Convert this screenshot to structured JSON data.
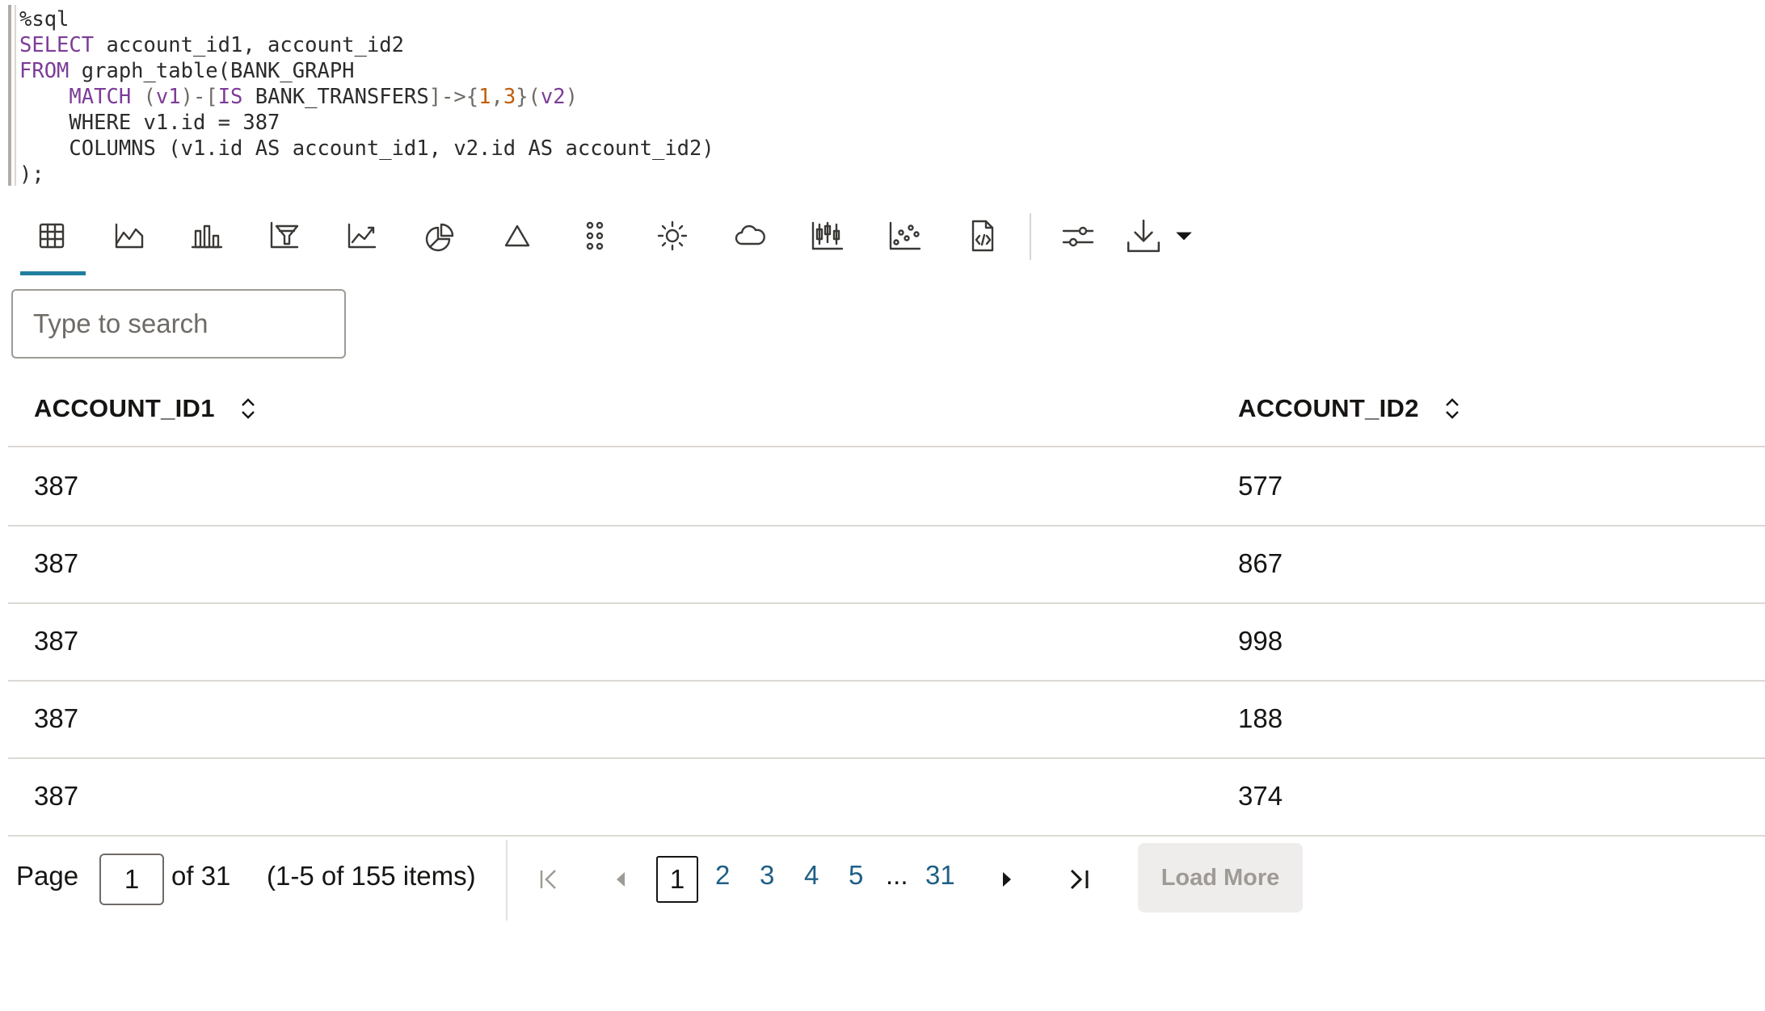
{
  "editor": {
    "line1": "%sql",
    "kw_select": "SELECT",
    "select_cols": " account_id1, account_id2",
    "kw_from": "FROM",
    "from_rest": " graph_table(BANK_GRAPH",
    "kw_match": "MATCH",
    "v1": "v1",
    "kw_is": "IS",
    "edge_label": " BANK_TRANSFERS",
    "min": "1",
    "max": "3",
    "v2": "v2",
    "where_line": "WHERE v1.id = 387",
    "columns_line": "COLUMNS (v1.id AS account_id1, v2.id AS account_id2)",
    "close_line": ");"
  },
  "toolbar": {
    "items": [
      {
        "name": "table-view-button",
        "icon": "grid-icon",
        "active": true
      },
      {
        "name": "area-chart-button",
        "icon": "area-chart-icon"
      },
      {
        "name": "bar-chart-button",
        "icon": "bar-chart-icon"
      },
      {
        "name": "funnel-chart-button",
        "icon": "funnel-chart-icon"
      },
      {
        "name": "line-chart-button",
        "icon": "line-chart-icon"
      },
      {
        "name": "pie-chart-button",
        "icon": "pie-chart-icon"
      },
      {
        "name": "pyramid-chart-button",
        "icon": "triangle-icon"
      },
      {
        "name": "scatter-grid-button",
        "icon": "dot-grid-icon"
      },
      {
        "name": "sunburst-chart-button",
        "icon": "sun-icon"
      },
      {
        "name": "tag-cloud-button",
        "icon": "cloud-icon"
      },
      {
        "name": "box-plot-button",
        "icon": "box-plot-icon"
      },
      {
        "name": "scatter-chart-button",
        "icon": "scatter-icon"
      },
      {
        "name": "html-view-button",
        "icon": "code-file-icon"
      },
      {
        "name": "settings-button",
        "icon": "sliders-icon"
      },
      {
        "name": "download-button",
        "icon": "download-icon"
      }
    ],
    "accent_color": "#227e9e"
  },
  "search": {
    "placeholder": "Type to search",
    "value": ""
  },
  "table": {
    "columns": [
      "ACCOUNT_ID1",
      "ACCOUNT_ID2"
    ],
    "rows": [
      [
        "387",
        "577"
      ],
      [
        "387",
        "867"
      ],
      [
        "387",
        "998"
      ],
      [
        "387",
        "188"
      ],
      [
        "387",
        "374"
      ]
    ]
  },
  "pagination": {
    "page_label": "Page",
    "current_page": "1",
    "of_label": "of 31",
    "items_label": "(1-5 of 155 items)",
    "pages": [
      "1",
      "2",
      "3",
      "4",
      "5"
    ],
    "ellipsis": "...",
    "last_page": "31",
    "load_more_label": "Load More"
  }
}
